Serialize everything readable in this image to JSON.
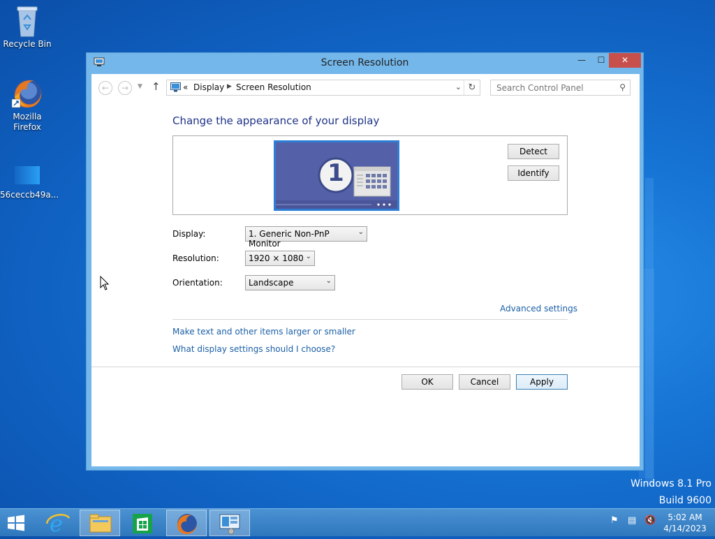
{
  "desktop": {
    "icons": [
      {
        "label": "Recycle Bin"
      },
      {
        "label_line1": "Mozilla",
        "label_line2": "Firefox"
      },
      {
        "label": "56ceccb49a..."
      }
    ],
    "os_name": "Windows 8.1 Pro",
    "os_build": "Build 9600"
  },
  "window": {
    "title": "Screen Resolution",
    "controls": {
      "minimize": "—",
      "maximize": "☐",
      "close": "✕"
    },
    "address": {
      "overflow": "«",
      "crumbs": [
        "Display",
        "Screen Resolution"
      ]
    },
    "search": {
      "placeholder": "Search Control Panel"
    },
    "heading": "Change the appearance of your display",
    "monitor_number": "1",
    "buttons": {
      "detect": "Detect",
      "identify": "Identify",
      "ok": "OK",
      "cancel": "Cancel",
      "apply": "Apply"
    },
    "fields": {
      "display_label": "Display:",
      "display_value": "1. Generic Non-PnP Monitor",
      "resolution_label": "Resolution:",
      "resolution_value": "1920 × 1080",
      "orientation_label": "Orientation:",
      "orientation_value": "Landscape"
    },
    "links": {
      "advanced": "Advanced settings",
      "text_size": "Make text and other items larger or smaller",
      "what_settings": "What display settings should I choose?"
    }
  },
  "taskbar": {
    "clock_time": "5:02 AM",
    "clock_date": "4/14/2023"
  },
  "colors": {
    "link": "#1a5fa6",
    "heading": "#1e3287",
    "window_frame": "#74b7ea",
    "close_button": "#c7504c"
  }
}
